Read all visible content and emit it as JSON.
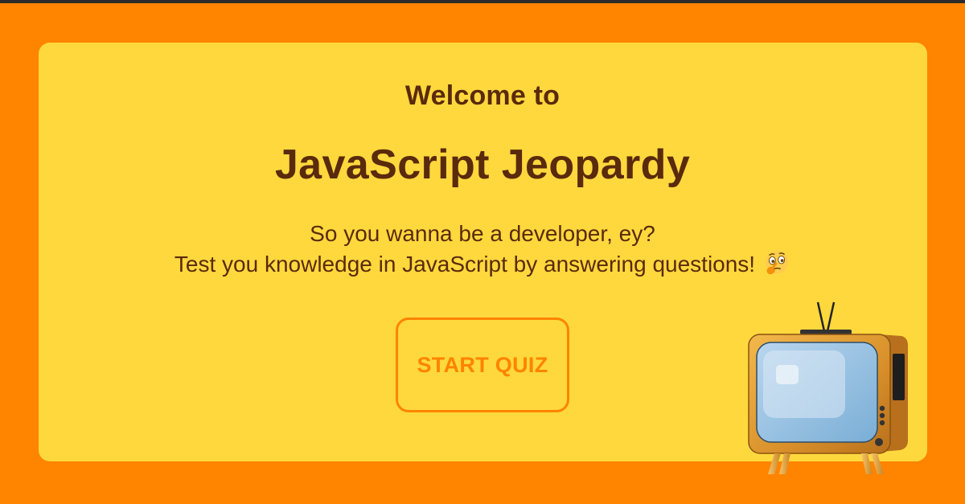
{
  "hero": {
    "welcome": "Welcome to",
    "title": "JavaScript Jeopardy",
    "subtitle_line1": "So you wanna be a developer, ey?",
    "subtitle_line2": "Test you knowledge in JavaScript by answering questions!"
  },
  "actions": {
    "start_label": "START QUIZ"
  },
  "icons": {
    "subtitle_emoji": "thinking-face-icon",
    "illustration": "retro-tv-icon"
  },
  "colors": {
    "background": "#FF8400",
    "card": "#FFD83D",
    "text": "#5a2a0c",
    "accent": "#FF8400"
  }
}
